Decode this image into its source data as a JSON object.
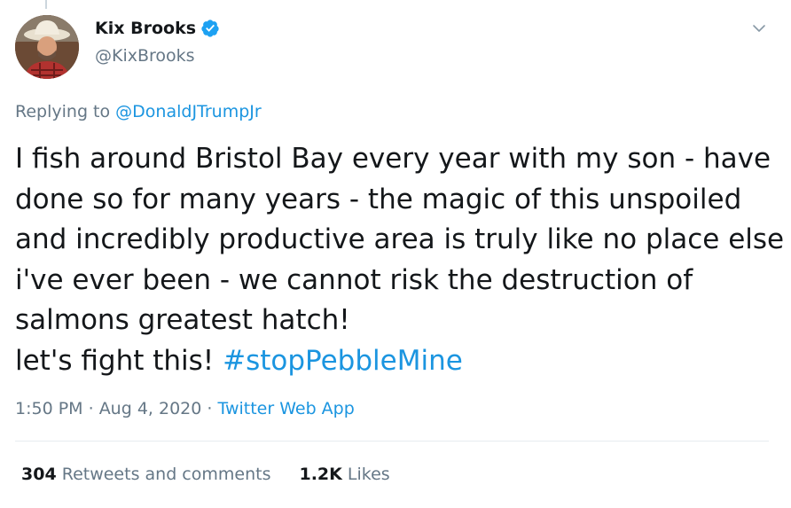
{
  "user": {
    "display_name": "Kix Brooks",
    "handle": "@KixBrooks",
    "verified": true
  },
  "icons": {
    "verified": "verified-badge-icon",
    "caret": "chevron-down-icon",
    "avatar": "profile-photo"
  },
  "reply": {
    "prefix": "Replying to",
    "mention": "@DonaldJTrumpJr"
  },
  "tweet": {
    "lines": [
      "I fish around Bristol Bay every year with my son - have",
      "done so for many years - the magic of this unspoiled",
      "and incredibly productive area is truly like no place else",
      "i've ever been - we cannot risk the destruction of",
      "salmons greatest hatch!"
    ],
    "last_line_prefix": "let's fight this!",
    "hashtag": "#stopPebbleMine"
  },
  "meta": {
    "time": "1:50 PM",
    "sep1": " · ",
    "date": "Aug 4, 2020",
    "sep2": " · ",
    "source": "Twitter Web App"
  },
  "stats": {
    "retweets_count": "304",
    "retweets_label": "Retweets and comments",
    "likes_count": "1.2K",
    "likes_label": "Likes"
  },
  "colors": {
    "link": "#1b95e0",
    "secondary_text": "#657786",
    "verified_badge": "#1da1f2",
    "divider": "#e6ecf0"
  }
}
